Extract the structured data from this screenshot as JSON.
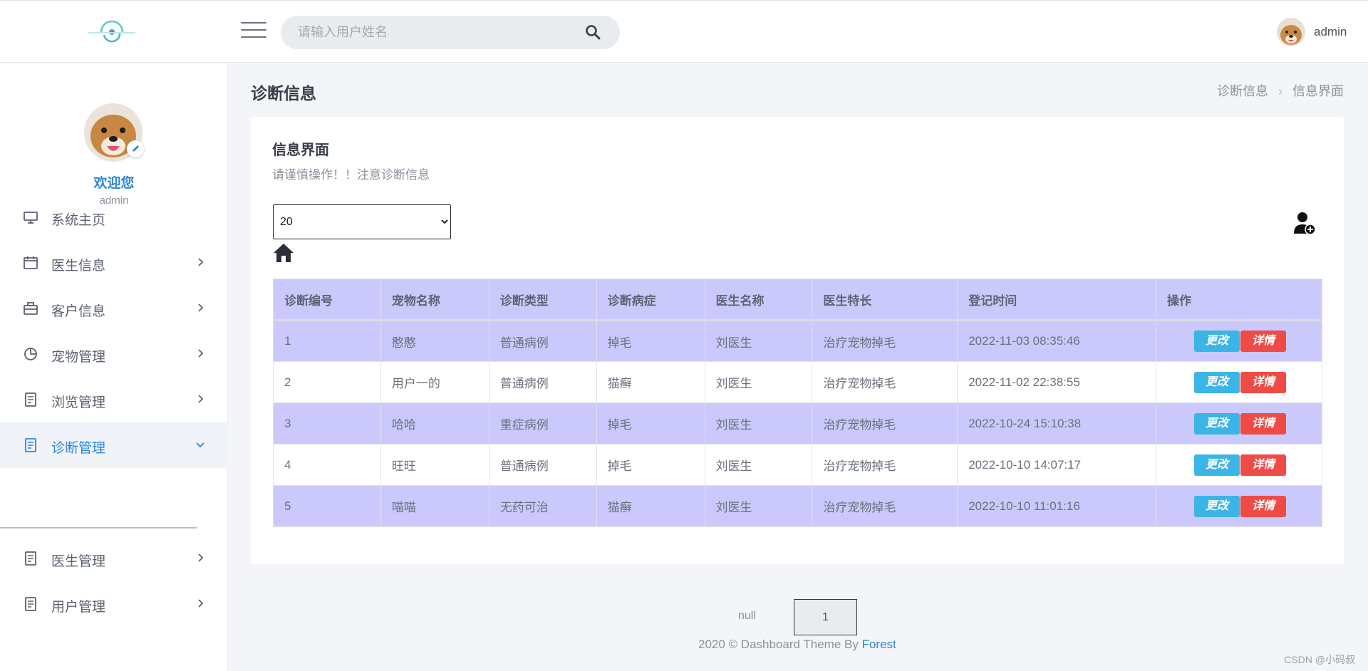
{
  "header": {
    "search_placeholder": "请输入用户姓名",
    "user_name": "admin"
  },
  "sidebar": {
    "welcome": "欢迎您",
    "profile_name": "admin",
    "items": [
      {
        "label": "系统主页",
        "icon": "monitor-icon"
      },
      {
        "label": "医生信息",
        "icon": "calendar-icon"
      },
      {
        "label": "客户信息",
        "icon": "briefcase-icon"
      },
      {
        "label": "宠物管理",
        "icon": "pie-chart-icon"
      },
      {
        "label": "浏览管理",
        "icon": "document-icon"
      },
      {
        "label": "诊断管理",
        "icon": "document-icon"
      },
      {
        "label": "医生管理",
        "icon": "document-icon"
      },
      {
        "label": "用户管理",
        "icon": "document-icon"
      }
    ],
    "divider": "————————————————————————————————"
  },
  "main": {
    "page_title": "诊断信息",
    "breadcrumb": [
      "诊断信息",
      "信息界面"
    ],
    "card_title": "信息界面",
    "card_subtitle": "请谨慎操作！！注意诊断信息",
    "page_size": "20"
  },
  "table": {
    "columns": [
      "诊断编号",
      "宠物名称",
      "诊断类型",
      "诊断病症",
      "医生名称",
      "医生特长",
      "登记时间",
      "操作"
    ],
    "rows": [
      [
        "1",
        "憨憨",
        "普通病例",
        "掉毛",
        "刘医生",
        "治疗宠物掉毛",
        "2022-11-03 08:35:46"
      ],
      [
        "2",
        "用户一的",
        "普通病例",
        "猫癣",
        "刘医生",
        "治疗宠物掉毛",
        "2022-11-02 22:38:55"
      ],
      [
        "3",
        "哈哈",
        "重症病例",
        "掉毛",
        "刘医生",
        "治疗宠物掉毛",
        "2022-10-24 15:10:38"
      ],
      [
        "4",
        "旺旺",
        "普通病例",
        "掉毛",
        "刘医生",
        "治疗宠物掉毛",
        "2022-10-10 14:07:17"
      ],
      [
        "5",
        "喵喵",
        "无药可治",
        "猫癣",
        "刘医生",
        "治疗宠物掉毛",
        "2022-10-10 11:01:16"
      ]
    ],
    "edit_label": "更改",
    "detail_label": "详情"
  },
  "pager": {
    "prev": "null",
    "current": "1"
  },
  "footer": {
    "text": "2020 © Dashboard Theme By ",
    "link": "Forest"
  },
  "watermark": "CSDN @小码叔",
  "colors": {
    "accent": "#2e86d6",
    "row_highlight": "#cbc9fb",
    "edit_button": "#3bb4e6",
    "detail_button": "#ef4b46"
  }
}
